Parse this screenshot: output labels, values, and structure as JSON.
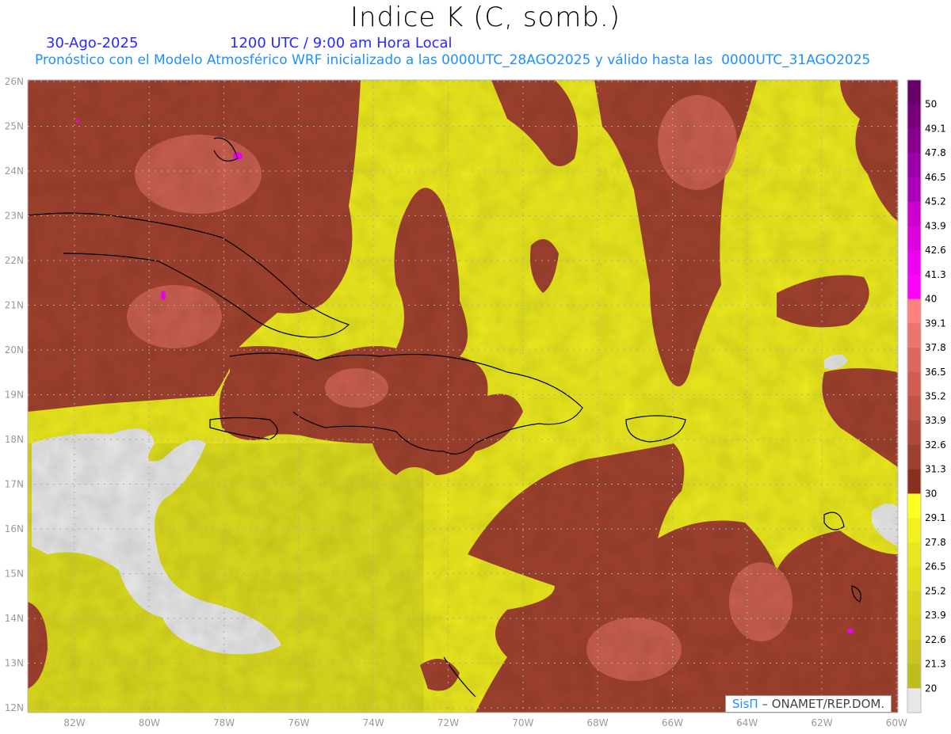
{
  "header": {
    "title": "Indice K (C, somb.)",
    "date": "30-Ago-2025",
    "time": "1200 UTC / 9:00 am Hora Local",
    "subtitle": "Pronóstico con el Modelo Atmosférico WRF inicializado a las 0000UTC_28AGO2025 y válido hasta las  0000UTC_31AGO2025"
  },
  "map": {
    "lat_labels": [
      "26N",
      "25N",
      "24N",
      "23N",
      "22N",
      "21N",
      "20N",
      "19N",
      "18N",
      "17N",
      "16N",
      "15N",
      "14N",
      "13N",
      "12N"
    ],
    "lon_labels": [
      "82W",
      "80W",
      "78W",
      "76W",
      "74W",
      "72W",
      "70W",
      "68W",
      "66W",
      "64W",
      "62W",
      "60W"
    ],
    "colors": {
      "low": "#e8e8e8",
      "yellow": "#f5f21e",
      "maroon": "#9a3a28",
      "maroon_light": "#b84e3e",
      "pink": "#e27060",
      "magenta": "#ff00ff"
    }
  },
  "colorbar": {
    "labels": [
      "50",
      "49.1",
      "47.8",
      "46.5",
      "45.2",
      "43.9",
      "42.6",
      "41.3",
      "40",
      "39.1",
      "37.8",
      "36.5",
      "35.2",
      "33.9",
      "32.6",
      "31.3",
      "30",
      "29.1",
      "27.8",
      "26.5",
      "25.2",
      "23.9",
      "22.6",
      "21.3",
      "20"
    ],
    "colors": [
      "#660066",
      "#77007a",
      "#880090",
      "#9900a8",
      "#aa00bb",
      "#cc00cc",
      "#dd00dd",
      "#ee00ee",
      "#ff00ff",
      "#ff8080",
      "#ec7470",
      "#de6860",
      "#cf5e50",
      "#bf5445",
      "#ad4a3a",
      "#9c4030",
      "#873020",
      "#ffff20",
      "#f4f21e",
      "#e8e61d",
      "#e2e01d",
      "#d8d61e",
      "#d2d01e",
      "#c8c61f",
      "#bfbc1f",
      "#e8e8e8"
    ]
  },
  "credit": {
    "logo": "SisΠ",
    "text": "– ONAMET/REP.DOM."
  }
}
